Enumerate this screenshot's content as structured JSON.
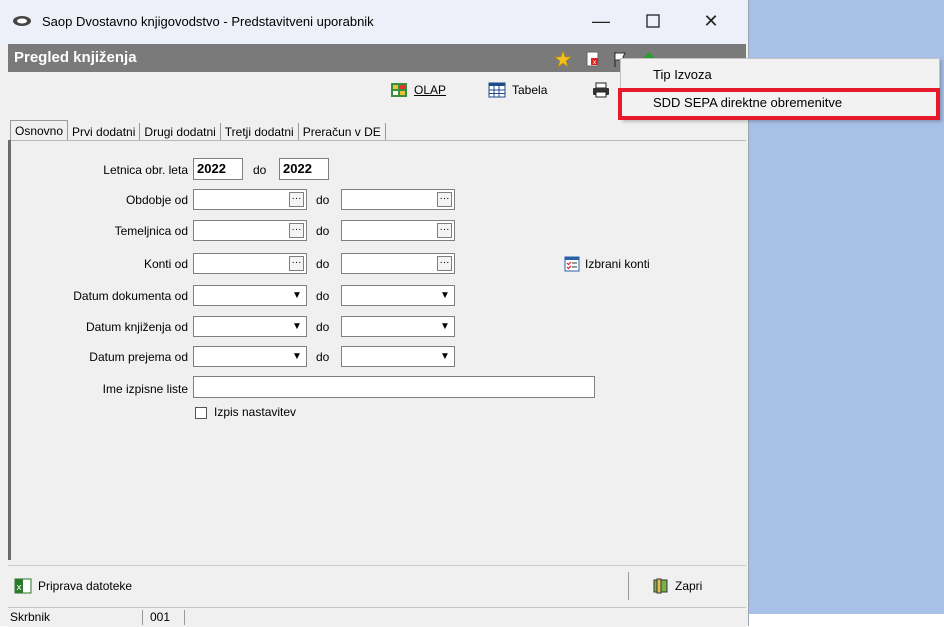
{
  "window": {
    "title": "Saop Dvostavno knjigovodstvo - Predstavitveni uporabnik",
    "controls": [
      "minimize-icon",
      "maximize-icon",
      "close-icon"
    ]
  },
  "subheader": {
    "title": "Pregled knjiženja"
  },
  "toolbar": {
    "olap_label": "OLAP",
    "tabela_label": "Tabela"
  },
  "tabs": [
    "Osnovno",
    "Prvi dodatni",
    "Drugi dodatni",
    "Tretji dodatni",
    "Preračun v DE"
  ],
  "form": {
    "letnica_label": "Letnica obr. leta",
    "letnica_from": "2022",
    "do": "do",
    "letnica_to": "2022",
    "obdobje_label": "Obdobje od",
    "temeljnica_label": "Temeljnica od",
    "konti_label": "Konti od",
    "datum_dok_label": "Datum dokumenta od",
    "datum_knj_label": "Datum knjiženja od",
    "datum_prej_label": "Datum prejema od",
    "ime_label": "Ime izpisne liste",
    "izpis_label": "Izpis nastavitev",
    "izbrani_konti": "Izbrani konti"
  },
  "bottom": {
    "priprava": "Priprava datoteke",
    "zapri": "Zapri"
  },
  "status": {
    "user": "Skrbnik",
    "code": "001"
  },
  "menu": {
    "item1": "Tip Izvoza",
    "item2": "SDD SEPA direktne obremenitve"
  },
  "colors": {
    "highlight": "#e8192c",
    "subheader": "#7a7a7a",
    "desktop": "#a7c0e6"
  }
}
